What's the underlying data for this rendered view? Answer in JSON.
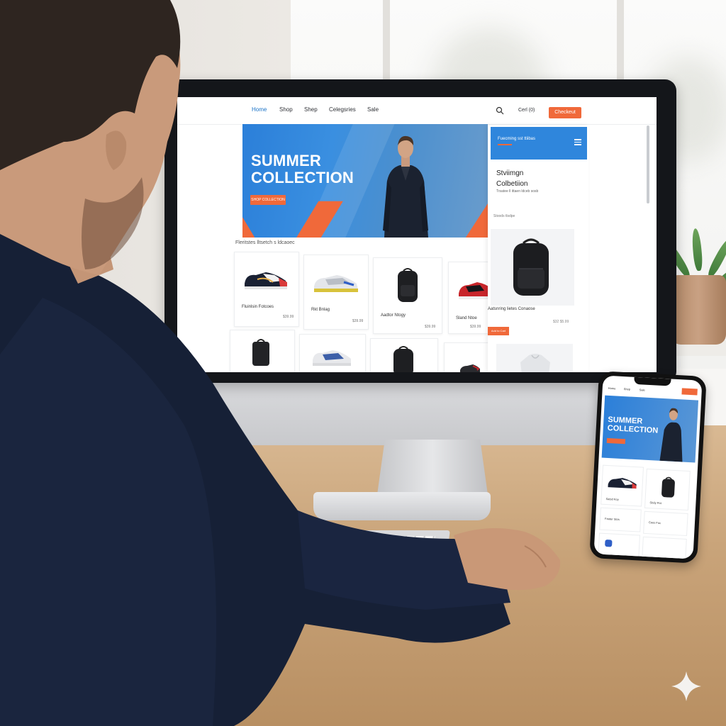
{
  "site": {
    "nav": {
      "items": [
        "Home",
        "Shop",
        "Shep",
        "Celegsries",
        "Sale"
      ],
      "cart_label": "Cerl (0)",
      "checkout_label": "Checkeut"
    },
    "hero": {
      "title_line1": "SUMMER",
      "title_line2": "COLLECTION",
      "button_label": "SHOP COLLECTION"
    },
    "featured_section_title": "Fleritstes  lltsetch s ldcaoec",
    "products_row1": [
      {
        "name": "Fluinlsin Fotcoes",
        "price": "$39.99"
      },
      {
        "name": "Rkt Bnlag",
        "price": "$39.99"
      },
      {
        "name": "Aadtor Ntogy",
        "price": "$39.99"
      },
      {
        "name": "Sland Ntoe",
        "price": "$39.99"
      }
    ],
    "side_panel": {
      "header_title": "Fuecming sst ttiibas",
      "title_line1": "Stviimgn",
      "title_line2": "Colbetiion",
      "subtitle": "Trsatee ll ittaen ldceb sosb",
      "section_label": "Stoods  tlsdpe",
      "product_name": "Aatsnring lietes Conaose",
      "product_price": "$32 $5.99",
      "button_label": "Add to Cart"
    }
  },
  "phone": {
    "nav_items": [
      "Home",
      "Shop",
      "Sale"
    ],
    "hero_line1": "SUMMER",
    "hero_line2": "COLLECTION",
    "products": [
      {
        "name": "Satsd Koy"
      },
      {
        "name": "Slsiiy Pot"
      },
      {
        "name": "Fauter Stos"
      },
      {
        "name": "Cees Foc"
      }
    ]
  },
  "colors": {
    "accent_orange": "#f0693a",
    "brand_blue": "#2f86dc",
    "nav_active": "#1b73c7"
  },
  "icons": {
    "search": "search-icon",
    "menu": "hamburger-menu-icon",
    "sparkle": "sparkle-icon"
  }
}
